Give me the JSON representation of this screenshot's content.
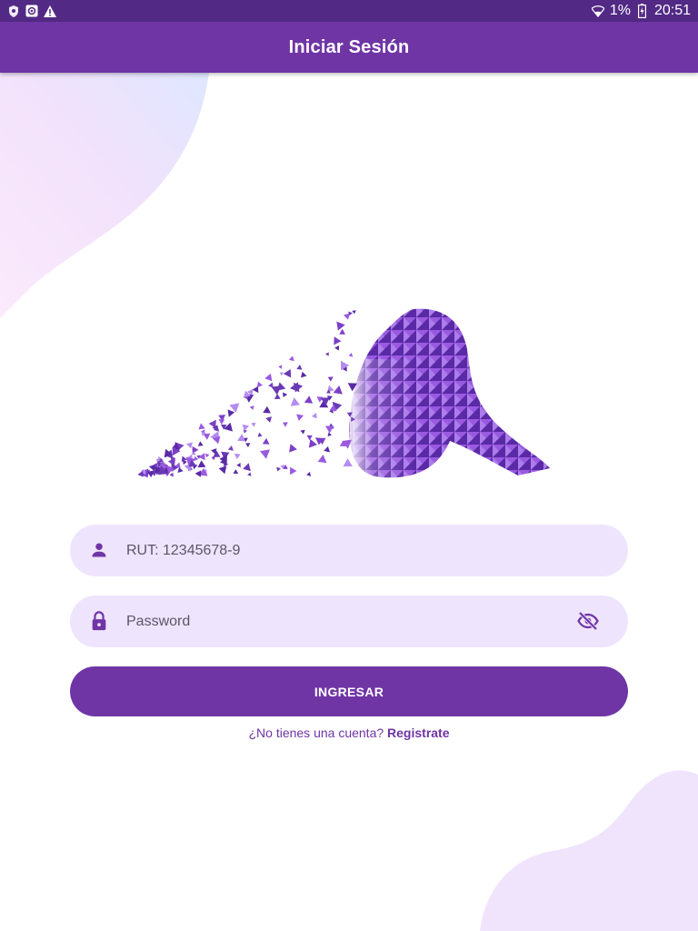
{
  "status_bar": {
    "battery": "1%",
    "time": "20:51",
    "icons": [
      "shield-icon",
      "screenshot-icon",
      "warning-icon",
      "wifi-icon",
      "battery-charging-icon"
    ]
  },
  "app_bar": {
    "title": "Iniciar Sesión"
  },
  "form": {
    "rut": {
      "placeholder": "RUT: 12345678-9",
      "value": "",
      "icon": "person-icon"
    },
    "password": {
      "placeholder": "Password",
      "value": "",
      "icon": "lock-icon",
      "toggle_icon": "visibility-off-icon"
    },
    "login_label": "INGRESAR"
  },
  "signup": {
    "prompt": "¿No tienes una cuenta?",
    "link": "Registrate"
  },
  "colors": {
    "primary": "#6f35a5",
    "field_bg": "#efe4fd",
    "status_bar": "#522a85"
  }
}
